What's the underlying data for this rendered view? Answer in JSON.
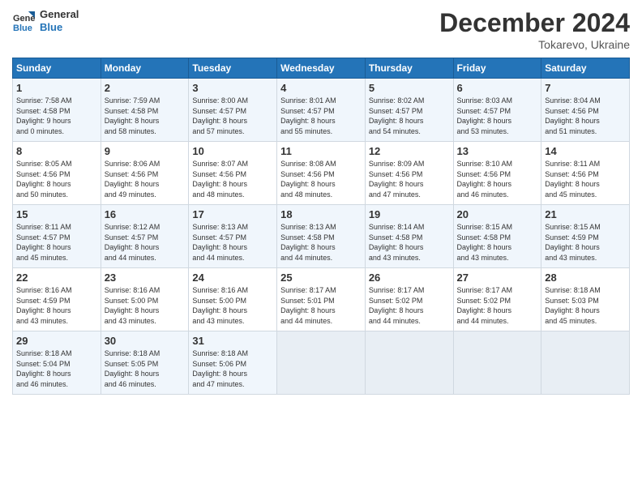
{
  "header": {
    "logo_line1": "General",
    "logo_line2": "Blue",
    "title": "December 2024",
    "location": "Tokarevo, Ukraine"
  },
  "days_of_week": [
    "Sunday",
    "Monday",
    "Tuesday",
    "Wednesday",
    "Thursday",
    "Friday",
    "Saturday"
  ],
  "weeks": [
    [
      {
        "day": "1",
        "info": "Sunrise: 7:58 AM\nSunset: 4:58 PM\nDaylight: 9 hours\nand 0 minutes."
      },
      {
        "day": "2",
        "info": "Sunrise: 7:59 AM\nSunset: 4:58 PM\nDaylight: 8 hours\nand 58 minutes."
      },
      {
        "day": "3",
        "info": "Sunrise: 8:00 AM\nSunset: 4:57 PM\nDaylight: 8 hours\nand 57 minutes."
      },
      {
        "day": "4",
        "info": "Sunrise: 8:01 AM\nSunset: 4:57 PM\nDaylight: 8 hours\nand 55 minutes."
      },
      {
        "day": "5",
        "info": "Sunrise: 8:02 AM\nSunset: 4:57 PM\nDaylight: 8 hours\nand 54 minutes."
      },
      {
        "day": "6",
        "info": "Sunrise: 8:03 AM\nSunset: 4:57 PM\nDaylight: 8 hours\nand 53 minutes."
      },
      {
        "day": "7",
        "info": "Sunrise: 8:04 AM\nSunset: 4:56 PM\nDaylight: 8 hours\nand 51 minutes."
      }
    ],
    [
      {
        "day": "8",
        "info": "Sunrise: 8:05 AM\nSunset: 4:56 PM\nDaylight: 8 hours\nand 50 minutes."
      },
      {
        "day": "9",
        "info": "Sunrise: 8:06 AM\nSunset: 4:56 PM\nDaylight: 8 hours\nand 49 minutes."
      },
      {
        "day": "10",
        "info": "Sunrise: 8:07 AM\nSunset: 4:56 PM\nDaylight: 8 hours\nand 48 minutes."
      },
      {
        "day": "11",
        "info": "Sunrise: 8:08 AM\nSunset: 4:56 PM\nDaylight: 8 hours\nand 48 minutes."
      },
      {
        "day": "12",
        "info": "Sunrise: 8:09 AM\nSunset: 4:56 PM\nDaylight: 8 hours\nand 47 minutes."
      },
      {
        "day": "13",
        "info": "Sunrise: 8:10 AM\nSunset: 4:56 PM\nDaylight: 8 hours\nand 46 minutes."
      },
      {
        "day": "14",
        "info": "Sunrise: 8:11 AM\nSunset: 4:56 PM\nDaylight: 8 hours\nand 45 minutes."
      }
    ],
    [
      {
        "day": "15",
        "info": "Sunrise: 8:11 AM\nSunset: 4:57 PM\nDaylight: 8 hours\nand 45 minutes."
      },
      {
        "day": "16",
        "info": "Sunrise: 8:12 AM\nSunset: 4:57 PM\nDaylight: 8 hours\nand 44 minutes."
      },
      {
        "day": "17",
        "info": "Sunrise: 8:13 AM\nSunset: 4:57 PM\nDaylight: 8 hours\nand 44 minutes."
      },
      {
        "day": "18",
        "info": "Sunrise: 8:13 AM\nSunset: 4:58 PM\nDaylight: 8 hours\nand 44 minutes."
      },
      {
        "day": "19",
        "info": "Sunrise: 8:14 AM\nSunset: 4:58 PM\nDaylight: 8 hours\nand 43 minutes."
      },
      {
        "day": "20",
        "info": "Sunrise: 8:15 AM\nSunset: 4:58 PM\nDaylight: 8 hours\nand 43 minutes."
      },
      {
        "day": "21",
        "info": "Sunrise: 8:15 AM\nSunset: 4:59 PM\nDaylight: 8 hours\nand 43 minutes."
      }
    ],
    [
      {
        "day": "22",
        "info": "Sunrise: 8:16 AM\nSunset: 4:59 PM\nDaylight: 8 hours\nand 43 minutes."
      },
      {
        "day": "23",
        "info": "Sunrise: 8:16 AM\nSunset: 5:00 PM\nDaylight: 8 hours\nand 43 minutes."
      },
      {
        "day": "24",
        "info": "Sunrise: 8:16 AM\nSunset: 5:00 PM\nDaylight: 8 hours\nand 43 minutes."
      },
      {
        "day": "25",
        "info": "Sunrise: 8:17 AM\nSunset: 5:01 PM\nDaylight: 8 hours\nand 44 minutes."
      },
      {
        "day": "26",
        "info": "Sunrise: 8:17 AM\nSunset: 5:02 PM\nDaylight: 8 hours\nand 44 minutes."
      },
      {
        "day": "27",
        "info": "Sunrise: 8:17 AM\nSunset: 5:02 PM\nDaylight: 8 hours\nand 44 minutes."
      },
      {
        "day": "28",
        "info": "Sunrise: 8:18 AM\nSunset: 5:03 PM\nDaylight: 8 hours\nand 45 minutes."
      }
    ],
    [
      {
        "day": "29",
        "info": "Sunrise: 8:18 AM\nSunset: 5:04 PM\nDaylight: 8 hours\nand 46 minutes."
      },
      {
        "day": "30",
        "info": "Sunrise: 8:18 AM\nSunset: 5:05 PM\nDaylight: 8 hours\nand 46 minutes."
      },
      {
        "day": "31",
        "info": "Sunrise: 8:18 AM\nSunset: 5:06 PM\nDaylight: 8 hours\nand 47 minutes."
      },
      {
        "day": "",
        "info": ""
      },
      {
        "day": "",
        "info": ""
      },
      {
        "day": "",
        "info": ""
      },
      {
        "day": "",
        "info": ""
      }
    ]
  ]
}
